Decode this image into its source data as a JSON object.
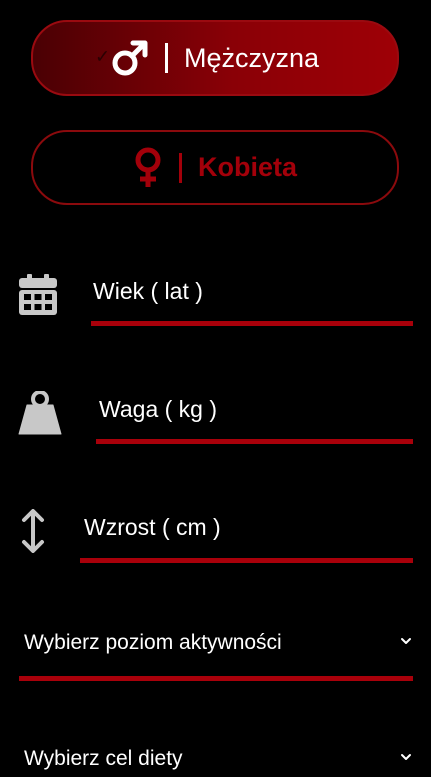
{
  "gender": {
    "male_label": "Mężczyzna",
    "female_label": "Kobieta",
    "male_check": "✓"
  },
  "fields": {
    "age_label": "Wiek ( lat )",
    "weight_label": "Waga ( kg )",
    "height_label": "Wzrost ( cm )"
  },
  "selects": {
    "activity_label": "Wybierz poziom aktywności",
    "diet_label": "Wybierz cel diety"
  },
  "icons": {
    "age": "calendar-icon",
    "weight": "weight-icon",
    "height": "vertical-arrows-icon",
    "male": "male-symbol-icon",
    "female": "female-symbol-icon",
    "dropdown": "chevron-down-icon"
  },
  "colors": {
    "accent": "#a8000a",
    "background": "#000000",
    "icon_gray": "#c8c8c8"
  }
}
